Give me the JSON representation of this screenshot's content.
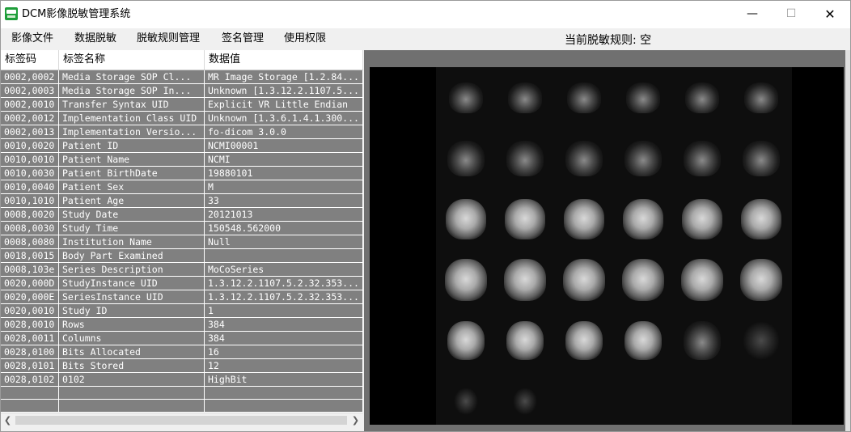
{
  "window": {
    "title": "DCM影像脱敏管理系统",
    "min_label": "—",
    "max_label": "☐",
    "close_label": "✕"
  },
  "menu": {
    "items": [
      "影像文件",
      "数据脱敏",
      "脱敏规则管理",
      "签名管理",
      "使用权限"
    ]
  },
  "status": {
    "current_rule": "当前脱敏规则: 空"
  },
  "table": {
    "headers": [
      "标签码",
      "标签名称",
      "数据值"
    ],
    "rows": [
      [
        "0002,0002",
        "Media  Storage SOP Cl...",
        "MR Image Storage [1.2.84..."
      ],
      [
        "0002,0003",
        "Media  Storage SOP In...",
        "Unknown [1.3.12.2.1107.5..."
      ],
      [
        "0002,0010",
        "Transfer  Syntax UID",
        "Explicit VR Little Endian"
      ],
      [
        "0002,0012",
        "Implementation Class UID",
        "Unknown [1.3.6.1.4.1.300..."
      ],
      [
        "0002,0013",
        "Implementation Versio...",
        "fo-dicom 3.0.0"
      ],
      [
        "0010,0020",
        "Patient ID",
        "NCMI00001"
      ],
      [
        "0010,0010",
        "Patient Name",
        "NCMI"
      ],
      [
        "0010,0030",
        "Patient BirthDate",
        "19880101"
      ],
      [
        "0010,0040",
        "Patient Sex",
        "M"
      ],
      [
        "0010,1010",
        "Patient Age",
        "33"
      ],
      [
        "0008,0020",
        "Study Date",
        "20121013"
      ],
      [
        "0008,0030",
        "Study Time",
        "150548.562000"
      ],
      [
        "0008,0080",
        "Institution Name",
        "Null"
      ],
      [
        "0018,0015",
        "Body Part Examined",
        ""
      ],
      [
        "0008,103e",
        "Series Description",
        "MoCoSeries"
      ],
      [
        "0020,000D",
        "StudyInstance UID",
        "1.3.12.2.1107.5.2.32.353..."
      ],
      [
        "0020,000E",
        "SeriesInstance UID",
        "1.3.12.2.1107.5.2.32.353..."
      ],
      [
        "0020,0010",
        "Study ID",
        "1"
      ],
      [
        "0028,0010",
        "Rows",
        "384"
      ],
      [
        "0028,0011",
        "Columns",
        "384"
      ],
      [
        "0028,0100",
        "Bits Allocated",
        "16"
      ],
      [
        "0028,0101",
        "Bits Stored",
        "12"
      ],
      [
        "0028,0102",
        "0102",
        "HighBit"
      ]
    ],
    "empty_rows": 2
  },
  "icons": {
    "app": "app-logo-icon",
    "scroll_left": "chevron-left-icon",
    "scroll_right": "chevron-right-icon"
  }
}
